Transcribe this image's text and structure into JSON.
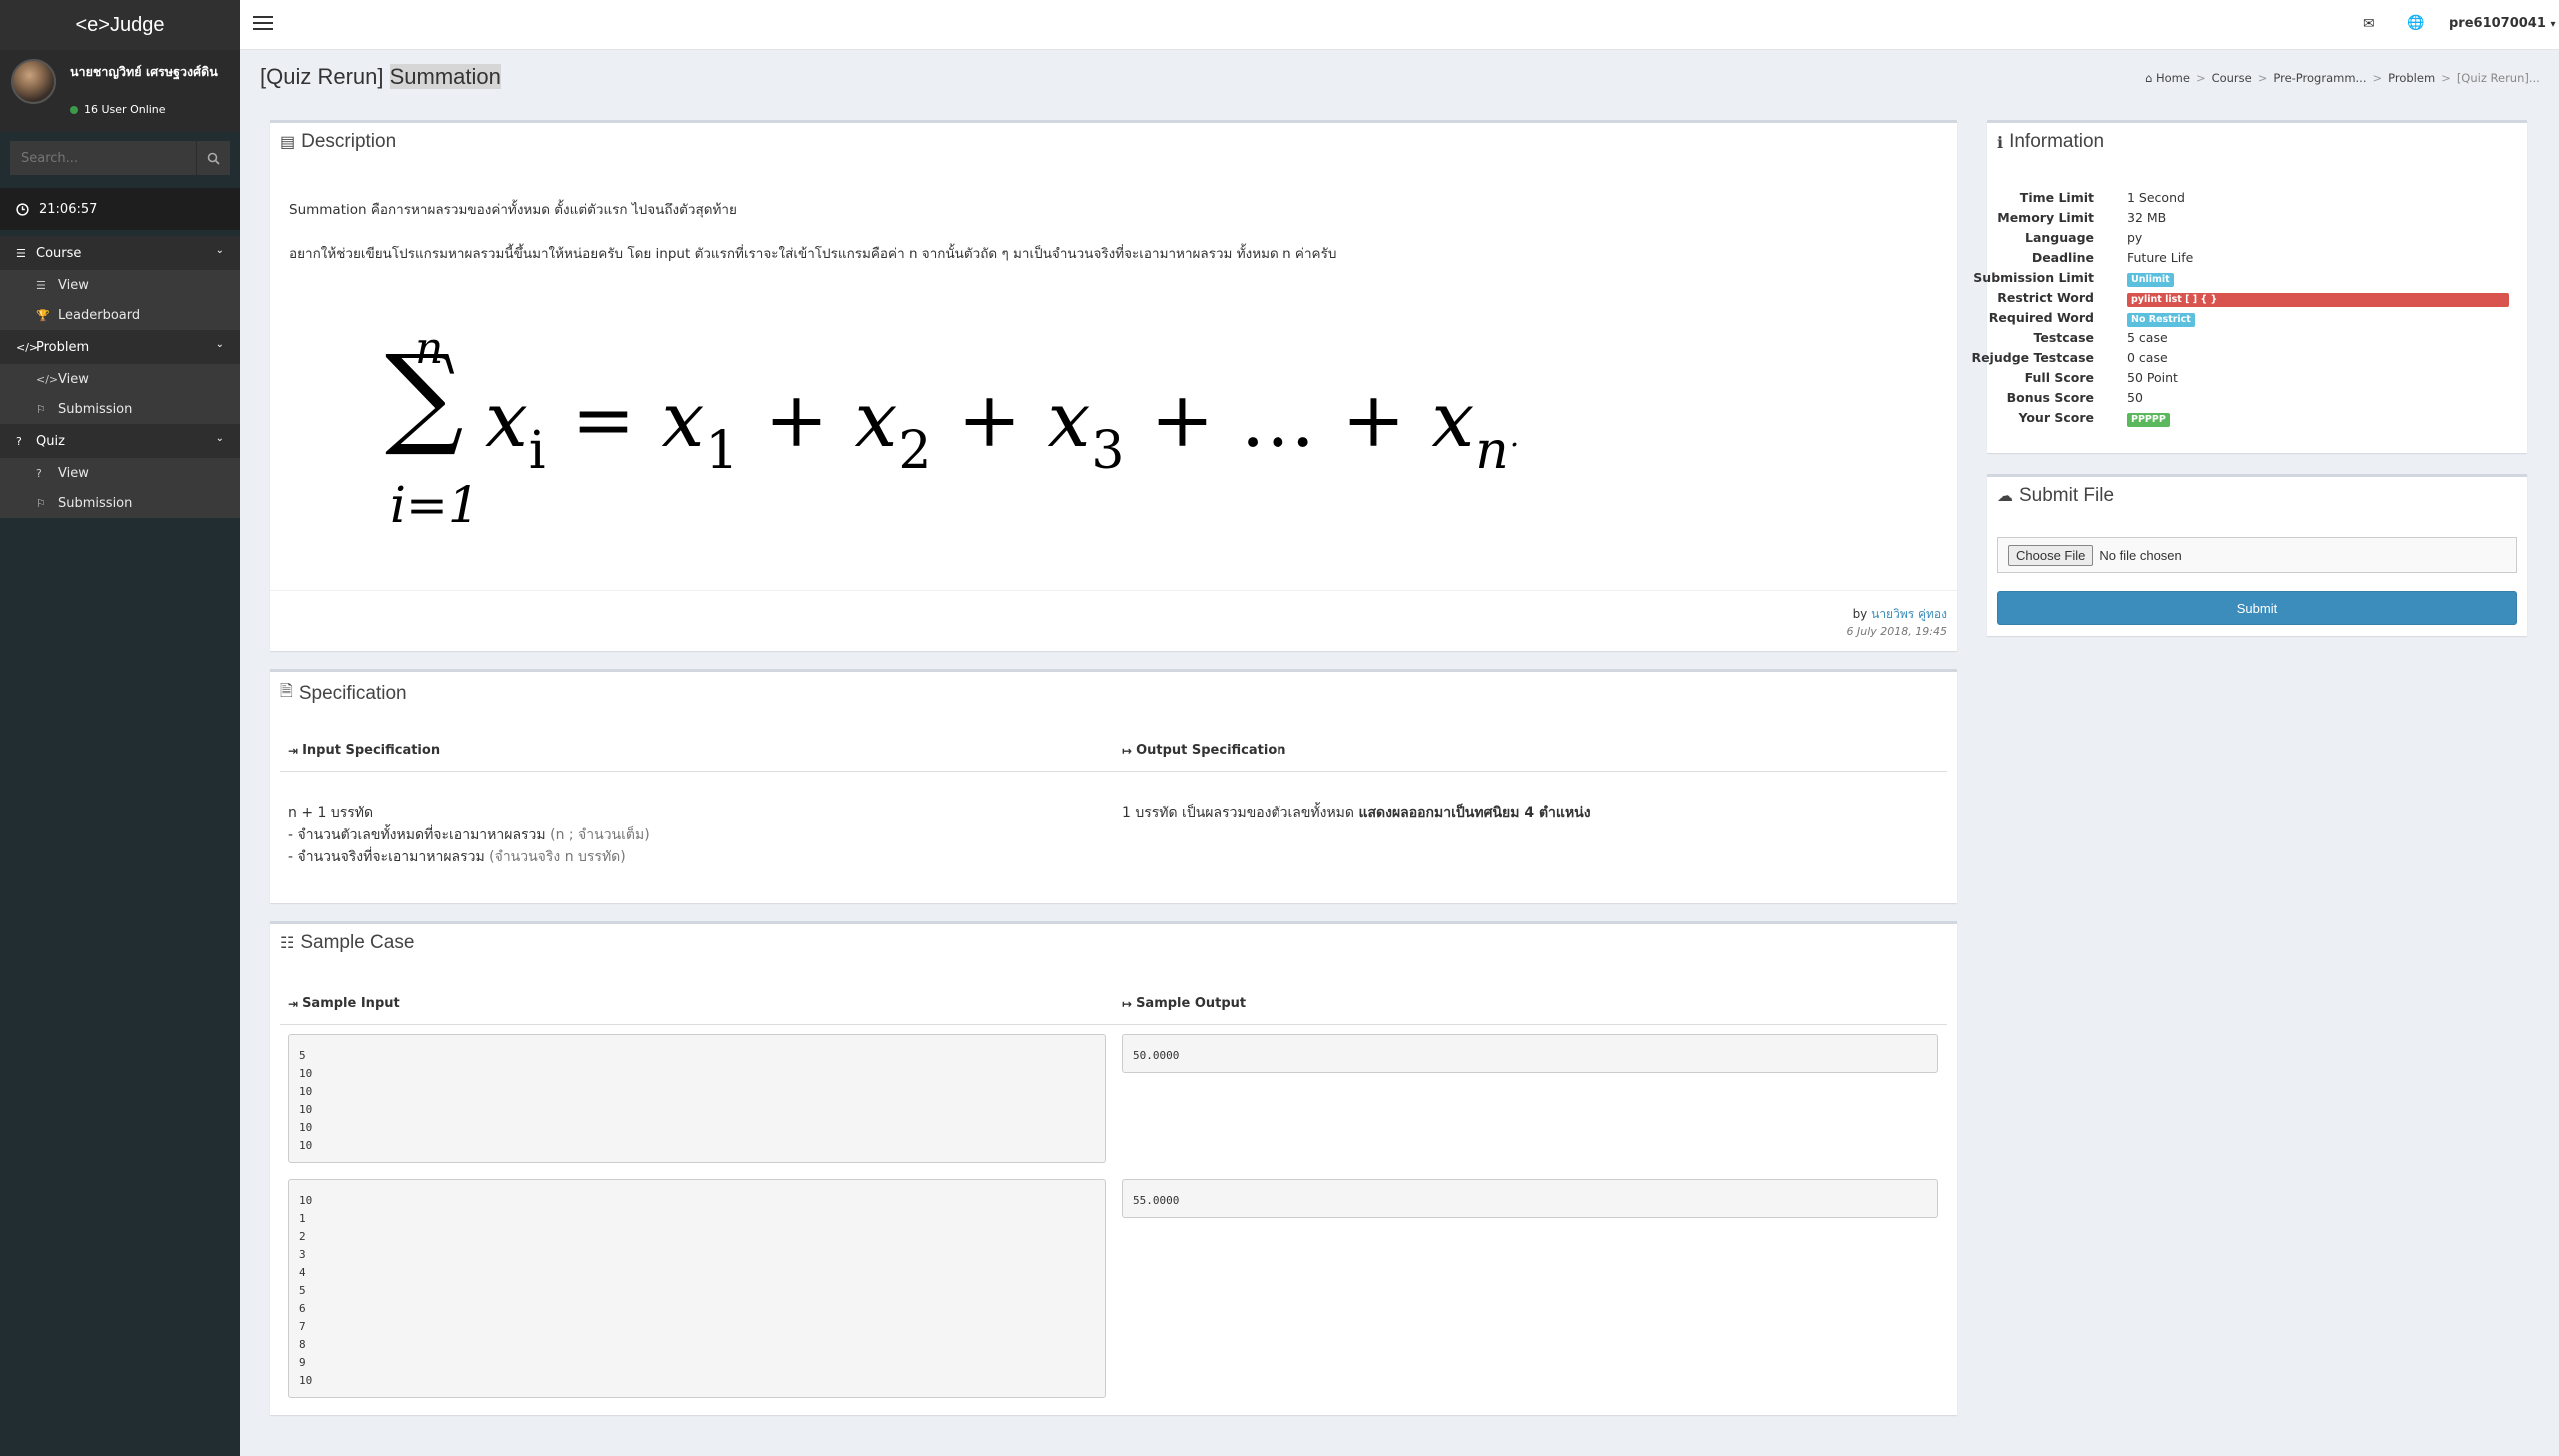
{
  "app": {
    "brand": "<e>Judge"
  },
  "user": {
    "name": "นายชาญวิทย์ เศรษฐวงศ์ดิน",
    "status": "16 User Online",
    "username": "pre61070041"
  },
  "sidebar": {
    "search_placeholder": "Search...",
    "clock": "21:06:57",
    "sections": [
      {
        "label": "Course",
        "items": [
          {
            "label": "View"
          },
          {
            "label": "Leaderboard"
          }
        ]
      },
      {
        "label": "Problem",
        "items": [
          {
            "label": "View"
          },
          {
            "label": "Submission"
          }
        ]
      },
      {
        "label": "Quiz",
        "items": [
          {
            "label": "View"
          },
          {
            "label": "Submission"
          }
        ]
      }
    ]
  },
  "page": {
    "title_prefix": "[Quiz Rerun] ",
    "title_main": "Summation"
  },
  "breadcrumb": [
    "Home",
    "Course",
    "Pre-Programm...",
    "Problem",
    "[Quiz Rerun]..."
  ],
  "description": {
    "title": "Description",
    "p1": "Summation คือการหาผลรวมของค่าทั้งหมด ตั้งแต่ตัวแรก ไปจนถึงตัวสุดท้าย",
    "p2": "อยากให้ช่วยเขียนโปรแกรมหาผลรวมนี้ขึ้นมาให้หน่อยครับ โดย input ตัวแรกที่เราจะใส่เข้าโปรแกรมคือค่า n จากนั้นตัวถัด ๆ มาเป็นจำนวนจริงที่จะเอามาหาผลรวม ทั้งหมด n ค่าครับ",
    "formula": {
      "upper": "n",
      "sigma": "∑",
      "lower": "i=1",
      "lhs": "x",
      "lhs_sub": "i",
      "eq": " = ",
      "t1": "x",
      "s1": "1",
      "plus": " + ",
      "t2": "x",
      "s2": "2",
      "t3": "x",
      "s3": "3",
      "dots": " + … + ",
      "tn": "x",
      "sn": "n",
      "end": "."
    },
    "by_label": "by",
    "author": "นายวิพร คู่ทอง",
    "date": "6 July 2018, 19:45"
  },
  "specification": {
    "title": "Specification",
    "input_header": "Input Specification",
    "output_header": "Output Specification",
    "input_lines": [
      {
        "text": "n + 1 บรรทัด",
        "note": ""
      },
      {
        "text": "- จำนวนตัวเลขทั้งหมดที่จะเอามาหาผลรวม ",
        "note": "(n ; จำนวนเต็ม)"
      },
      {
        "text": "- จำนวนจริงที่จะเอามาหาผลรวม ",
        "note": "(จำนวนจริง n บรรทัด)"
      }
    ],
    "output_text": "1 บรรทัด เป็นผลรวมของตัวเลขทั้งหมด ",
    "output_bold": "แสดงผลออกมาเป็นทศนิยม 4 ตำแหน่ง"
  },
  "sample": {
    "title": "Sample Case",
    "input_header": "Sample Input",
    "output_header": "Sample Output",
    "cases": [
      {
        "input": "5\n10\n10\n10\n10\n10",
        "output": "50.0000"
      },
      {
        "input": "10\n1\n2\n3\n4\n5\n6\n7\n8\n9\n10",
        "output": "55.0000"
      }
    ]
  },
  "information": {
    "title": "Information",
    "rows": [
      {
        "key": "Time Limit",
        "value": "1 Second"
      },
      {
        "key": "Memory Limit",
        "value": "32 MB"
      },
      {
        "key": "Language",
        "value": "py"
      },
      {
        "key": "Deadline",
        "value": "Future Life"
      },
      {
        "key": "Submission Limit",
        "badge": "Unlimit",
        "badge_color": "#5bc0de"
      },
      {
        "key": "Restrict Word",
        "badge": "pylint list [ ] { }",
        "badge_color": "#d9534f"
      },
      {
        "key": "Required Word",
        "badge": "No Restrict",
        "badge_color": "#5bc0de"
      },
      {
        "key": "Testcase",
        "value": "5 case"
      },
      {
        "key": "Rejudge Testcase",
        "value": "0 case"
      },
      {
        "key": "Full Score",
        "value": "50 Point"
      },
      {
        "key": "Bonus Score",
        "value": "50"
      },
      {
        "key": "Your Score",
        "badge": "PPPPP",
        "badge_color": "#5cb85c"
      }
    ]
  },
  "submit": {
    "title": "Submit File",
    "choose_label": "Choose File",
    "file_status": "No file chosen",
    "button": "Submit"
  }
}
